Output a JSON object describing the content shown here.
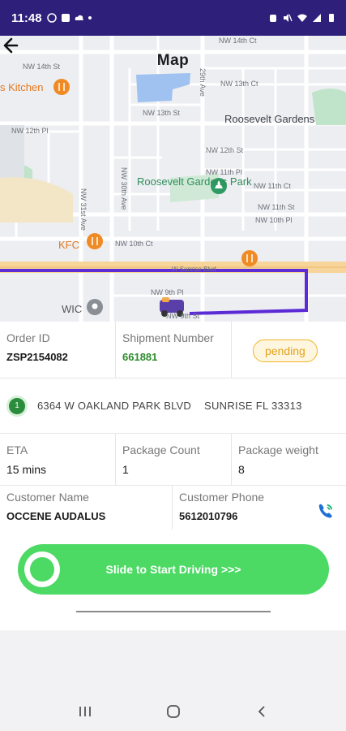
{
  "status_bar": {
    "time": "11:48"
  },
  "map": {
    "title": "Map",
    "labels": {
      "kitchen": "s Kitchen",
      "nw14th_left": "NW 14th St",
      "nw14th_ct": "NW 14th Ct",
      "nw13th_ct": "NW 13th Ct",
      "nw13th_st": "NW 13th St",
      "roosevelt_gardens": "Roosevelt Gardens",
      "nw12th_pl": "NW 12th Pl",
      "nw12th_st": "NW 12th St",
      "nw11th_pl": "NW 11th Pl",
      "nw11th_ct": "NW 11th Ct",
      "nw11th_st": "NW 11th St",
      "nw10th_pl": "NW 10th Pl",
      "nw10th_ct": "NW 10th Ct",
      "roosevelt_park": "Roosevelt Gardens Park",
      "nw31st_ave": "NW 31st Ave",
      "nw30th_ave": "NW 30th Ave",
      "nw29th_ave": "29th Ave",
      "kfc": "KFC",
      "sunrise_blvd": "W Sunrise Blvd",
      "nw9th_pl": "NW 9th Pl",
      "nw9th_st": "NW 9th St",
      "wic": "WIC"
    }
  },
  "order": {
    "order_id_label": "Order ID",
    "order_id": "ZSP2154082",
    "shipment_label": "Shipment Number",
    "shipment_number": "661881",
    "status": "pending"
  },
  "stop": {
    "number": "1",
    "address": "6364 W OAKLAND PARK BLVD",
    "city": "SUNRISE  FL  33313"
  },
  "details": {
    "eta_label": "ETA",
    "eta": "15 mins",
    "package_count_label": "Package Count",
    "package_count": "1",
    "package_weight_label": "Package weight",
    "package_weight": "8"
  },
  "customer": {
    "name_label": "Customer Name",
    "name": "OCCENE AUDALUS",
    "phone_label": "Customer Phone",
    "phone": "5612010796"
  },
  "slider": {
    "label": "Slide to Start Driving >>>"
  },
  "colors": {
    "status_bar": "#2e1f7a",
    "route": "#5b2bd6",
    "slider": "#4cd964",
    "pending": "#f0b429",
    "shipment": "#2e8b2e"
  },
  "icons": {
    "back": "arrow-left",
    "phone": "phone-call",
    "nav_recent": "three-bars",
    "nav_home": "rounded-square",
    "nav_back": "chevron-left"
  }
}
